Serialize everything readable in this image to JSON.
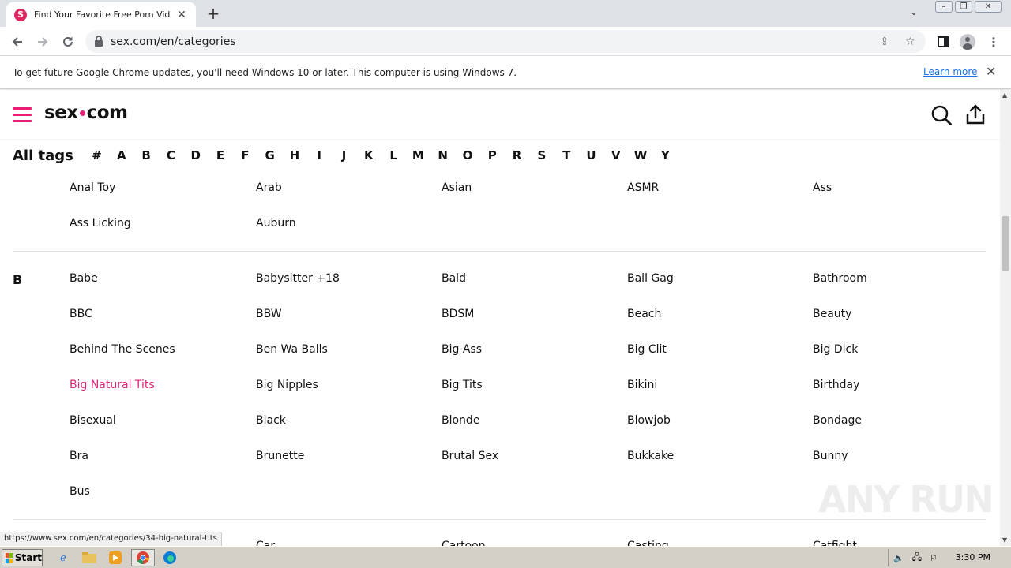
{
  "browser": {
    "tab_title": "Find Your Favorite Free Porn Videos",
    "tab_favicon": "S",
    "url": "sex.com/en/categories",
    "infobar_text": "To get future Google Chrome updates, you'll need Windows 10 or later. This computer is using Windows 7.",
    "infobar_link": "Learn more",
    "status_url": "https://www.sex.com/en/categories/34-big-natural-tits"
  },
  "site": {
    "logo_left": "sex",
    "logo_right": "com",
    "accent": "#e91e78"
  },
  "alpha_nav": {
    "title": "All tags",
    "letters": [
      "#",
      "A",
      "B",
      "C",
      "D",
      "E",
      "F",
      "G",
      "H",
      "I",
      "J",
      "K",
      "L",
      "M",
      "N",
      "O",
      "P",
      "R",
      "S",
      "T",
      "U",
      "V",
      "W",
      "Y"
    ]
  },
  "groups": {
    "a": {
      "letter": "",
      "tags": [
        "Anal Toy",
        "Arab",
        "Asian",
        "ASMR",
        "Ass",
        "Ass Licking",
        "Auburn"
      ]
    },
    "b": {
      "letter": "B",
      "tags": [
        "Babe",
        "Babysitter +18",
        "Bald",
        "Ball Gag",
        "Bathroom",
        "BBC",
        "BBW",
        "BDSM",
        "Beach",
        "Beauty",
        "Behind The Scenes",
        "Ben Wa Balls",
        "Big Ass",
        "Big Clit",
        "Big Dick",
        "Big Natural Tits",
        "Big Nipples",
        "Big Tits",
        "Bikini",
        "Birthday",
        "Bisexual",
        "Black",
        "Blonde",
        "Blowjob",
        "Bondage",
        "Bra",
        "Brunette",
        "Brutal Sex",
        "Bukkake",
        "Bunny",
        "Bus"
      ]
    },
    "c": {
      "letter": "",
      "tags": [
        "",
        "Car",
        "Cartoon",
        "Casting",
        "Catfight"
      ]
    }
  },
  "hovered_tag": "Big Natural Tits",
  "taskbar": {
    "start_label": "Start",
    "clock": "3:30 PM"
  },
  "watermark": "ANY RUN"
}
